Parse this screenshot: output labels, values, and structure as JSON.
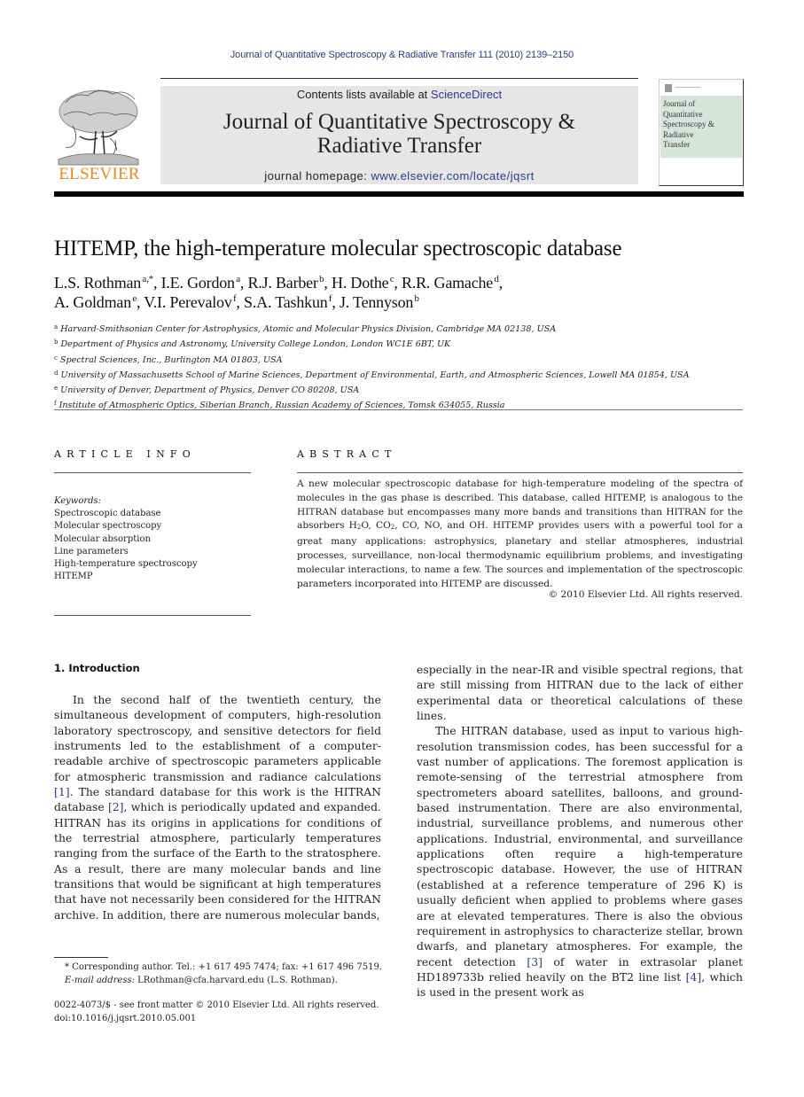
{
  "running_head": "Journal of Quantitative Spectroscopy & Radiative Transfer 111 (2010) 2139–2150",
  "masthead": {
    "publisher_logo_text": "ELSEVIER",
    "contents_prefix": "Contents lists available at ",
    "contents_link": "ScienceDirect",
    "journal_title_line1": "Journal of Quantitative Spectroscopy &",
    "journal_title_line2": "Radiative Transfer",
    "homepage_prefix": "journal homepage: ",
    "homepage_link": "www.elsevier.com/locate/jqsrt",
    "cover_lines": [
      "Journal of",
      "Quantitative",
      "Spectroscopy &",
      "Radiative",
      "Transfer"
    ],
    "colors": {
      "elsevier_orange": "#f08a1c",
      "link_blue": "#2b3a8c",
      "banner_gray": "#e6e6e6",
      "cover_green": "#d5e5dc"
    }
  },
  "article": {
    "title": "HITEMP, the high-temperature molecular spectroscopic database",
    "authors_line1": [
      {
        "name": "L.S. Rothman",
        "sup": "a,*",
        "sep": ", "
      },
      {
        "name": "I.E. Gordon",
        "sup": "a",
        "sep": ", "
      },
      {
        "name": "R.J. Barber",
        "sup": "b",
        "sep": ", "
      },
      {
        "name": "H. Dothe",
        "sup": "c",
        "sep": ", "
      },
      {
        "name": "R.R. Gamache",
        "sup": "d",
        "sep": ","
      }
    ],
    "authors_line2": [
      {
        "name": "A. Goldman",
        "sup": "e",
        "sep": ", "
      },
      {
        "name": "V.I. Perevalov",
        "sup": "f",
        "sep": ", "
      },
      {
        "name": "S.A. Tashkun",
        "sup": "f",
        "sep": ", "
      },
      {
        "name": "J. Tennyson",
        "sup": "b",
        "sep": ""
      }
    ],
    "affiliations": [
      {
        "mark": "a",
        "text": "Harvard-Smithsonian Center for Astrophysics, Atomic and Molecular Physics Division, Cambridge MA 02138, USA"
      },
      {
        "mark": "b",
        "text": "Department of Physics and Astronomy, University College London, London WC1E 6BT, UK"
      },
      {
        "mark": "c",
        "text": "Spectral Sciences, Inc., Burlington MA 01803, USA"
      },
      {
        "mark": "d",
        "text": "University of Massachusetts School of Marine Sciences, Department of Environmental, Earth, and Atmospheric Sciences, Lowell MA 01854, USA"
      },
      {
        "mark": "e",
        "text": "University of Denver, Department of Physics, Denver CO 80208, USA"
      },
      {
        "mark": "f",
        "text": "Institute of Atmospheric Optics, Siberian Branch, Russian Academy of Sciences, Tomsk 634055, Russia"
      }
    ]
  },
  "article_info": {
    "heading": "ARTICLE INFO",
    "keywords_label": "Keywords:",
    "keywords": [
      "Spectroscopic database",
      "Molecular spectroscopy",
      "Molecular absorption",
      "Line parameters",
      "High-temperature spectroscopy",
      "HITEMP"
    ]
  },
  "abstract": {
    "heading": "ABSTRACT",
    "text_part1": "A new molecular spectroscopic database for high-temperature modeling of the spectra of molecules in the gas phase is described. This database, called HITEMP, is analogous to the HITRAN database but encompasses many more bands and transitions than HITRAN for the absorbers H",
    "h2o_sub": "2",
    "text_part2": "O, CO",
    "co2_sub": "2",
    "text_part3": ", CO, NO, and OH. HITEMP provides users with a powerful tool for a great many applications: astrophysics, planetary and stellar atmospheres, industrial processes, surveillance, non-local thermodynamic equilibrium problems, and investigating molecular interactions, to name a few. The sources and implementation of the spectroscopic parameters incorporated into HITEMP are discussed.",
    "copyright": "© 2010 Elsevier Ltd. All rights reserved."
  },
  "body": {
    "intro_heading": "1.  Introduction",
    "left_p1_a": "In the second half of the twentieth century, the simultaneous development of computers, high-resolution laboratory spectroscopy, and sensitive detectors for field instruments led to the establishment of a computer-readable archive of spectroscopic parameters applicable for atmospheric transmission and radiance calculations ",
    "ref1": "[1]",
    "left_p1_b": ". The standard database for this work is the HITRAN database ",
    "ref2": "[2]",
    "left_p1_c": ", which is periodically updated and expanded. HITRAN has its origins in applications for conditions of the terrestrial atmosphere, particularly temperatures ranging from the surface of the Earth to the stratosphere. As a result, there are many molecular bands and line transitions that would be significant at high temperatures that have not necessarily been considered for the HITRAN archive. In addition, there are numerous molecular bands,",
    "right_p1": "especially in the near-IR and visible spectral regions, that are still missing from HITRAN due to the lack of either experimental data or theoretical calculations of these lines.",
    "right_p2_a": "The HITRAN database, used as input to various high-resolution transmission codes, has been successful for a vast number of applications. The foremost application is remote-sensing of the terrestrial atmosphere from spectrometers aboard satellites, balloons, and ground-based instrumentation. There are also environmental, industrial, surveillance problems, and numerous other applications. Industrial, environmental, and surveillance applications often require a high-temperature spectroscopic database. However, the use of HITRAN (established at a reference temperature of 296 K) is usually deficient when applied to problems where gases are at elevated temperatures. There is also the obvious requirement in astrophysics to characterize stellar, brown dwarfs, and planetary atmospheres. For example, the recent detection ",
    "ref3": "[3]",
    "right_p2_b": " of water in extrasolar planet HD189733b relied heavily on the BT2 line list ",
    "ref4": "[4]",
    "right_p2_c": ", which is used in the present work as"
  },
  "footnotes": {
    "corresponding": "* Corresponding author. Tel.: +1 617 495 7474; fax: +1 617 496 7519.",
    "email_label": "E-mail address:",
    "email_value": " LRothman@cfa.harvard.edu (L.S. Rothman).",
    "front_matter": "0022-4073/$ - see front matter © 2010 Elsevier Ltd. All rights reserved.",
    "doi": "doi:10.1016/j.jqsrt.2010.05.001"
  }
}
